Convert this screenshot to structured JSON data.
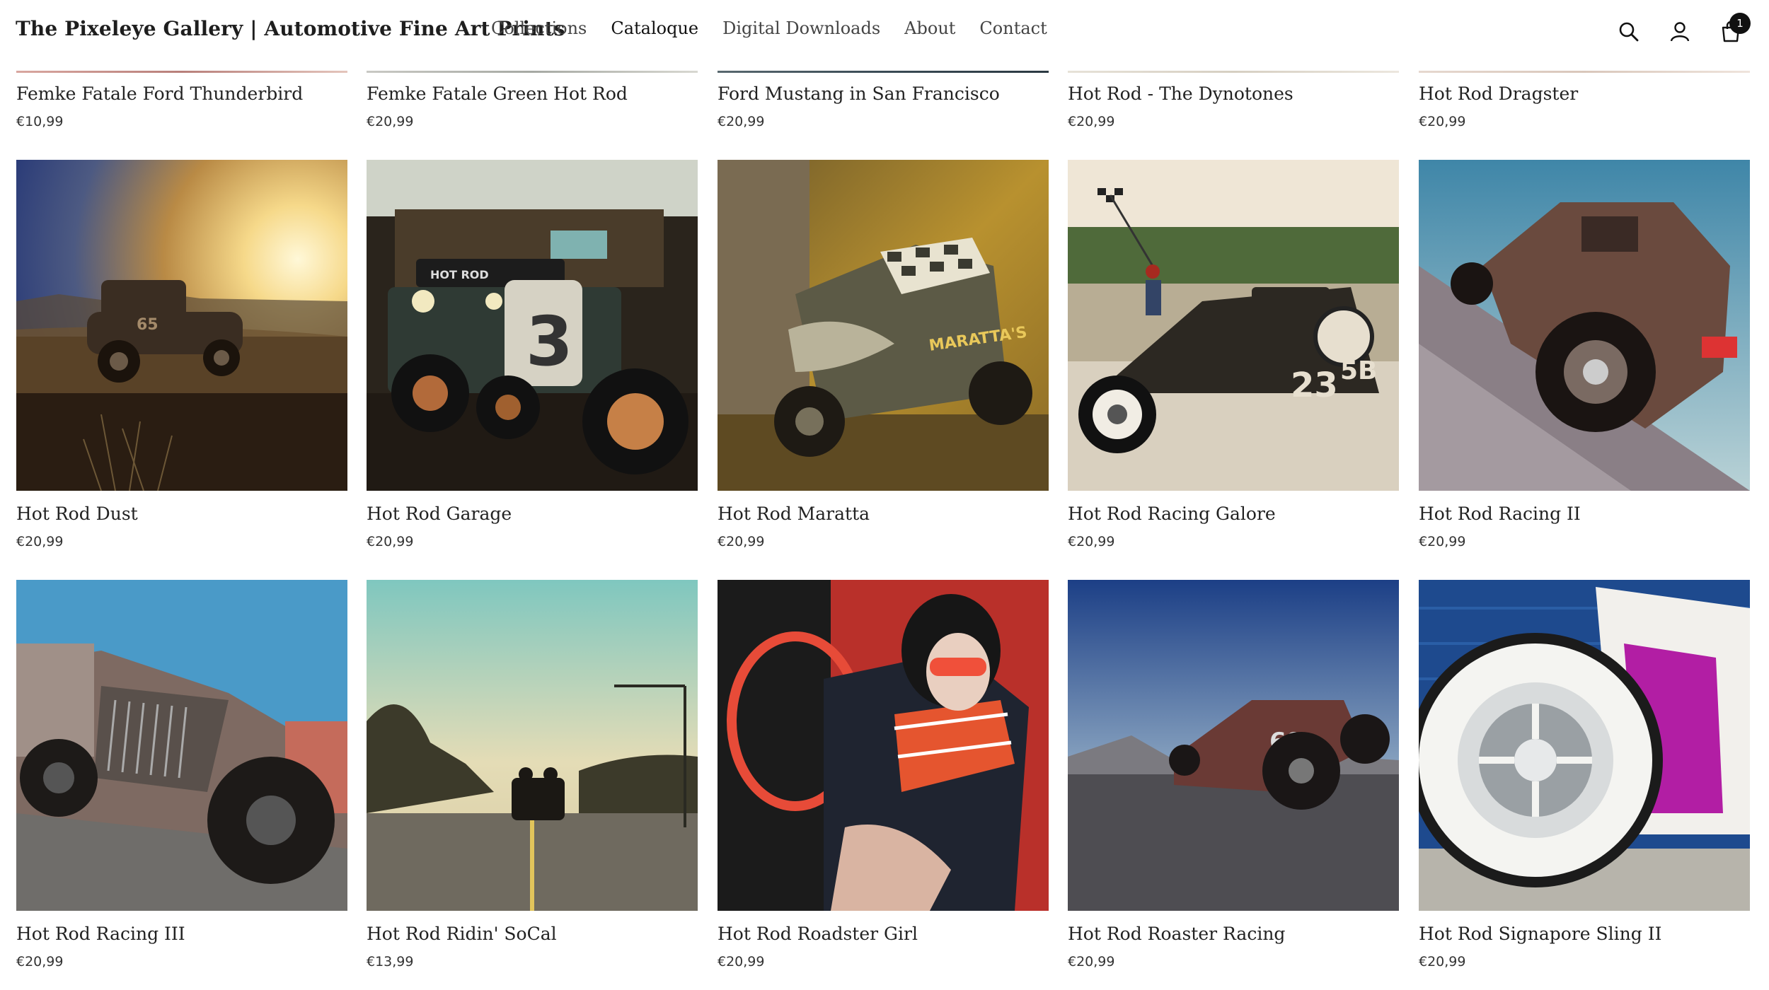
{
  "header": {
    "brand": "The Pixeleye Gallery | Automotive Fine Art Prints",
    "nav": [
      "Collections",
      "Cataloque",
      "Digital Downloads",
      "About",
      "Contact"
    ],
    "active_nav": "Cataloque",
    "icons": [
      "search-icon",
      "account-icon",
      "cart-icon"
    ],
    "cart_count": "1"
  },
  "products": {
    "row1": [
      {
        "title": "Femke Fatale Ford Thunderbird",
        "price": "€10,99"
      },
      {
        "title": "Femke Fatale Green Hot Rod",
        "price": "€20,99"
      },
      {
        "title": "Ford Mustang in San Francisco",
        "price": "€20,99"
      },
      {
        "title": "Hot Rod - The Dynotones",
        "price": "€20,99"
      },
      {
        "title": "Hot Rod Dragster",
        "price": "€20,99"
      }
    ],
    "row2": [
      {
        "title": "Hot Rod Dust",
        "price": "€20,99"
      },
      {
        "title": "Hot Rod Garage",
        "price": "€20,99"
      },
      {
        "title": "Hot Rod Maratta",
        "price": "€20,99"
      },
      {
        "title": "Hot Rod Racing Galore",
        "price": "€20,99"
      },
      {
        "title": "Hot Rod Racing II",
        "price": "€20,99"
      }
    ],
    "row3": [
      {
        "title": "Hot Rod Racing III",
        "price": "€20,99"
      },
      {
        "title": "Hot Rod Ridin' SoCal",
        "price": "€13,99"
      },
      {
        "title": "Hot Rod Roadster Girl",
        "price": "€20,99"
      },
      {
        "title": "Hot Rod Roaster Racing",
        "price": "€20,99"
      },
      {
        "title": "Hot Rod Signapore Sling II",
        "price": "€20,99"
      }
    ]
  },
  "image_text": {
    "dust_number": "65",
    "garage_number": "3",
    "garage_sign": "HOT ROD",
    "maratta_sign": "MARATTA'S",
    "galore_number": "23",
    "galore_number2": "5B",
    "roaster_number": "69"
  }
}
